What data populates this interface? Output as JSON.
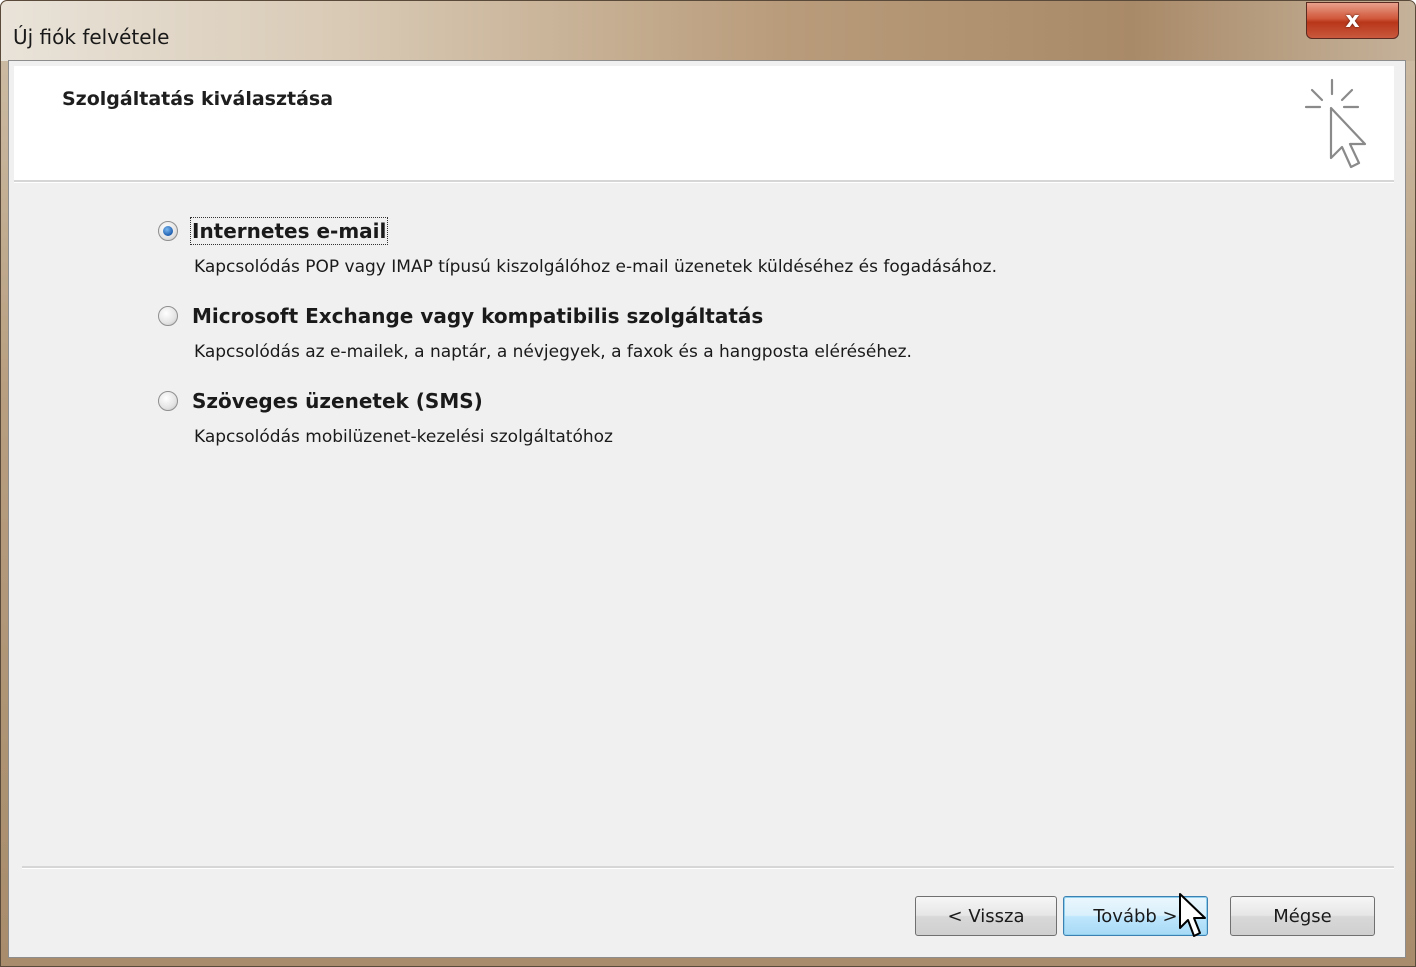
{
  "window": {
    "title": "Új fiók felvétele",
    "close_label": "x"
  },
  "header": {
    "title": "Szolgáltatás kiválasztása",
    "icon": "cursor-sparkle-icon"
  },
  "options": [
    {
      "label": "Internetes e-mail",
      "description": "Kapcsolódás POP vagy IMAP típusú kiszolgálóhoz e-mail üzenetek küldéséhez és fogadásához.",
      "selected": true
    },
    {
      "label": "Microsoft Exchange vagy kompatibilis szolgáltatás",
      "description": "Kapcsolódás az e-mailek, a naptár, a névjegyek, a faxok és a hangposta eléréséhez.",
      "selected": false
    },
    {
      "label": "Szöveges üzenetek (SMS)",
      "description": "Kapcsolódás mobilüzenet-kezelési szolgáltatóhoz",
      "selected": false
    }
  ],
  "buttons": {
    "back": "< Vissza",
    "next": "Tovább >",
    "cancel": "Mégse"
  },
  "colors": {
    "selected_radio": "#1f5fb0",
    "default_button_border": "#3c7fb1",
    "close_button": "#c9452a"
  }
}
